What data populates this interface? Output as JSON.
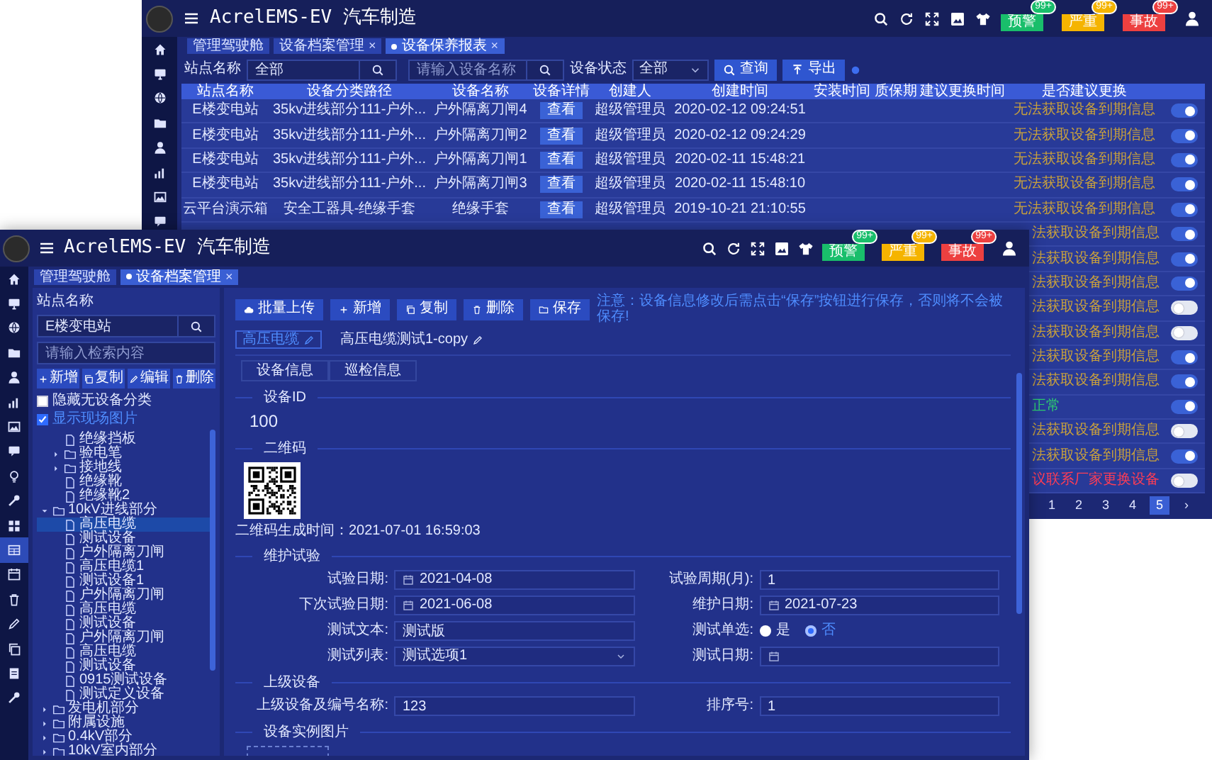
{
  "back_window": {
    "title": "AcrelEMS-EV 汽车制造",
    "alerts": [
      {
        "label": "预警",
        "count": "99+",
        "color": "#19be6b"
      },
      {
        "label": "严重",
        "count": "99+",
        "color": "#f5b400"
      },
      {
        "label": "事故",
        "count": "99+",
        "color": "#ed4040"
      }
    ],
    "tabs": [
      {
        "label": "管理驾驶舱",
        "selected": false
      },
      {
        "label": "设备档案管理",
        "close": "×",
        "selected": false
      },
      {
        "label": "设备保养报表",
        "close": "×",
        "selected": true
      }
    ],
    "filters": {
      "station_label": "站点名称",
      "station_value": "全部",
      "device_placeholder": "请输入设备名称",
      "status_label": "设备状态",
      "status_value": "全部",
      "query": "查询",
      "export": "导出"
    },
    "table": {
      "columns": [
        "站点名称",
        "设备分类路径",
        "设备名称",
        "设备详情",
        "创建人",
        "创建时间",
        "安装时间",
        "质保期",
        "建议更换时间",
        "是否建议更换"
      ],
      "rows": [
        {
          "station": "E楼变电站",
          "path": "35kv进线部分111-户外...",
          "device": "户外隔离刀闸4",
          "detail": "查看",
          "creator": "超级管理员",
          "created": "2020-02-12 09:24:51",
          "advice": "无法获取设备到期信息",
          "kind": "unknown",
          "on": true
        },
        {
          "station": "E楼变电站",
          "path": "35kv进线部分111-户外...",
          "device": "户外隔离刀闸2",
          "detail": "查看",
          "creator": "超级管理员",
          "created": "2020-02-12 09:24:29",
          "advice": "无法获取设备到期信息",
          "kind": "unknown",
          "on": true
        },
        {
          "station": "E楼变电站",
          "path": "35kv进线部分111-户外...",
          "device": "户外隔离刀闸1",
          "detail": "查看",
          "creator": "超级管理员",
          "created": "2020-02-11 15:48:21",
          "advice": "无法获取设备到期信息",
          "kind": "unknown",
          "on": true
        },
        {
          "station": "E楼变电站",
          "path": "35kv进线部分111-户外...",
          "device": "户外隔离刀闸3",
          "detail": "查看",
          "creator": "超级管理员",
          "created": "2020-02-11 15:48:10",
          "advice": "无法获取设备到期信息",
          "kind": "unknown",
          "on": true
        },
        {
          "station": "云平台演示箱",
          "path": "安全工器具-绝缘手套",
          "device": "绝缘手套",
          "detail": "查看",
          "creator": "超级管理员",
          "created": "2019-10-21 21:10:55",
          "advice": "无法获取设备到期信息",
          "kind": "unknown",
          "on": true
        }
      ],
      "covered_rows": [
        {
          "advice": "法获取设备到期信息",
          "kind": "unknown",
          "on": true
        },
        {
          "advice": "法获取设备到期信息",
          "kind": "unknown",
          "on": true
        },
        {
          "advice": "法获取设备到期信息",
          "kind": "unknown",
          "on": true
        },
        {
          "advice": "法获取设备到期信息",
          "kind": "unknown",
          "on": false
        },
        {
          "advice": "法获取设备到期信息",
          "kind": "unknown",
          "on": false
        },
        {
          "advice": "法获取设备到期信息",
          "kind": "unknown",
          "on": true
        },
        {
          "advice": "法获取设备到期信息",
          "kind": "unknown",
          "on": true
        },
        {
          "advice": "正常",
          "kind": "normal",
          "on": true
        },
        {
          "advice": "法获取设备到期信息",
          "kind": "unknown",
          "on": false
        },
        {
          "advice": "法获取设备到期信息",
          "kind": "unknown",
          "on": true
        },
        {
          "advice": "议联系厂家更换设备",
          "kind": "overdue",
          "on": false
        }
      ]
    },
    "pagination": [
      {
        "label": "1",
        "selected": false
      },
      {
        "label": "2",
        "selected": false
      },
      {
        "label": "3",
        "selected": false
      },
      {
        "label": "4",
        "selected": false
      },
      {
        "label": "5",
        "selected": true
      }
    ],
    "next": "›"
  },
  "front_window": {
    "title": "AcrelEMS-EV 汽车制造",
    "alerts": [
      {
        "label": "预警",
        "count": "99+",
        "color": "#19be6b"
      },
      {
        "label": "严重",
        "count": "99+",
        "color": "#f5b400"
      },
      {
        "label": "事故",
        "count": "99+",
        "color": "#ed4040"
      }
    ],
    "nav": [
      {
        "selected": false
      },
      {
        "selected": false
      },
      {
        "selected": false
      },
      {
        "selected": false
      },
      {
        "selected": false
      },
      {
        "selected": false
      },
      {
        "selected": false
      },
      {
        "selected": false
      },
      {
        "selected": false
      },
      {
        "selected": false
      },
      {
        "selected": false
      },
      {
        "selected": true
      },
      {
        "selected": false
      },
      {
        "selected": false
      },
      {
        "selected": false
      },
      {
        "selected": false
      },
      {
        "selected": false
      },
      {
        "selected": false
      }
    ],
    "tabs": [
      {
        "label": "管理驾驶舱",
        "selected": false
      },
      {
        "label": "设备档案管理",
        "close": "×",
        "selected": true
      }
    ],
    "tree_panel": {
      "station_label": "站点名称",
      "station_value": "E楼变电站",
      "search_placeholder": "请输入检索内容",
      "buttons": [
        {
          "kind": "add",
          "label": "新增"
        },
        {
          "kind": "copy",
          "label": "复制"
        },
        {
          "kind": "edit",
          "label": "编辑"
        },
        {
          "kind": "delete",
          "label": "删除"
        }
      ],
      "options": [
        {
          "label": "隐藏无设备分类",
          "checked": false
        },
        {
          "label": "显示现场图片",
          "checked": true
        }
      ],
      "tree": [
        {
          "children": [
            {
              "kind": "device",
              "label": "绝缘挡板",
              "selected": false
            },
            {
              "kind": "folder",
              "label": "验电笔",
              "expanded": false,
              "selected": false
            },
            {
              "kind": "folder",
              "label": "接地线",
              "expanded": false,
              "selected": false
            },
            {
              "kind": "device",
              "label": "绝缘靴",
              "selected": false
            },
            {
              "kind": "device",
              "label": "绝缘靴2",
              "selected": false
            }
          ]
        },
        {
          "kind": "folder",
          "label": "10kV进线部分",
          "expanded": true,
          "selected": false,
          "children": [
            {
              "kind": "device",
              "label": "高压电缆",
              "selected": true
            },
            {
              "kind": "device",
              "label": "测试设备",
              "selected": false
            },
            {
              "kind": "device",
              "label": "户外隔离刀闸",
              "selected": false
            },
            {
              "kind": "device",
              "label": "高压电缆1",
              "selected": false
            },
            {
              "kind": "device",
              "label": "测试设备1",
              "selected": false
            },
            {
              "kind": "device",
              "label": "户外隔离刀闸",
              "selected": false
            },
            {
              "kind": "device",
              "label": "高压电缆",
              "selected": false
            },
            {
              "kind": "device",
              "label": "测试设备",
              "selected": false
            },
            {
              "kind": "device",
              "label": "户外隔离刀闸",
              "selected": false
            },
            {
              "kind": "device",
              "label": "高压电缆",
              "selected": false
            },
            {
              "kind": "device",
              "label": "测试设备",
              "selected": false
            },
            {
              "kind": "device",
              "label": "0915测试设备",
              "selected": false
            },
            {
              "kind": "device",
              "label": "测试定义设备",
              "selected": false
            }
          ]
        },
        {
          "kind": "folder",
          "label": "发电机部分",
          "expanded": false,
          "selected": false
        },
        {
          "kind": "folder",
          "label": "附属设施",
          "expanded": false,
          "selected": false
        },
        {
          "kind": "folder",
          "label": "0.4kV部分",
          "expanded": false,
          "selected": false
        },
        {
          "kind": "folder",
          "label": "10kV室内部分",
          "expanded": false,
          "selected": false
        }
      ]
    },
    "toolbar": {
      "buttons": [
        {
          "kind": "upload",
          "label": "批量上传"
        },
        {
          "kind": "add",
          "label": "新增"
        },
        {
          "kind": "copy",
          "label": "复制"
        },
        {
          "kind": "delete",
          "label": "删除"
        },
        {
          "kind": "save",
          "label": "保存"
        }
      ],
      "notice": "注意：设备信息修改后需点击“保存”按钮进行保存，否则将不会被保存!"
    },
    "chips": [
      {
        "label": "高压电缆",
        "selected": true
      },
      {
        "label": "高压电缆测试1-copy",
        "selected": false
      }
    ],
    "detail_tabs": [
      {
        "label": "设备信息"
      },
      {
        "label": "巡检信息"
      }
    ],
    "sections": [
      {
        "kind": "value",
        "title": "设备ID",
        "value": "100"
      },
      {
        "kind": "qr",
        "title": "二维码",
        "caption": "二维码生成时间：2021-07-01 16:59:03"
      },
      {
        "kind": "fields",
        "title": "维护试验",
        "fields": [
          {
            "kind": "date",
            "label": "试验日期:",
            "value": "2021-04-08"
          },
          {
            "kind": "text",
            "label": "试验周期(月):",
            "value": "1"
          },
          {
            "kind": "date",
            "label": "下次试验日期:",
            "value": "2021-06-08"
          },
          {
            "kind": "date",
            "label": "维护日期:",
            "value": "2021-07-23"
          },
          {
            "kind": "text",
            "label": "测试文本:",
            "value": "测试版"
          },
          {
            "kind": "radio",
            "label": "测试单选:",
            "options": [
              {
                "label": "是",
                "selected": false
              },
              {
                "label": "否",
                "selected": true
              }
            ]
          },
          {
            "kind": "select",
            "label": "测试列表:",
            "value": "测试选项1"
          },
          {
            "kind": "date",
            "label": "测试日期:"
          }
        ]
      },
      {
        "kind": "fields",
        "title": "上级设备",
        "fields": [
          {
            "kind": "text",
            "label": "上级设备及编号名称:",
            "value": "123"
          },
          {
            "kind": "text",
            "label": "排序号:",
            "value": "1"
          }
        ]
      },
      {
        "kind": "upload",
        "title": "设备实例图片"
      }
    ]
  }
}
